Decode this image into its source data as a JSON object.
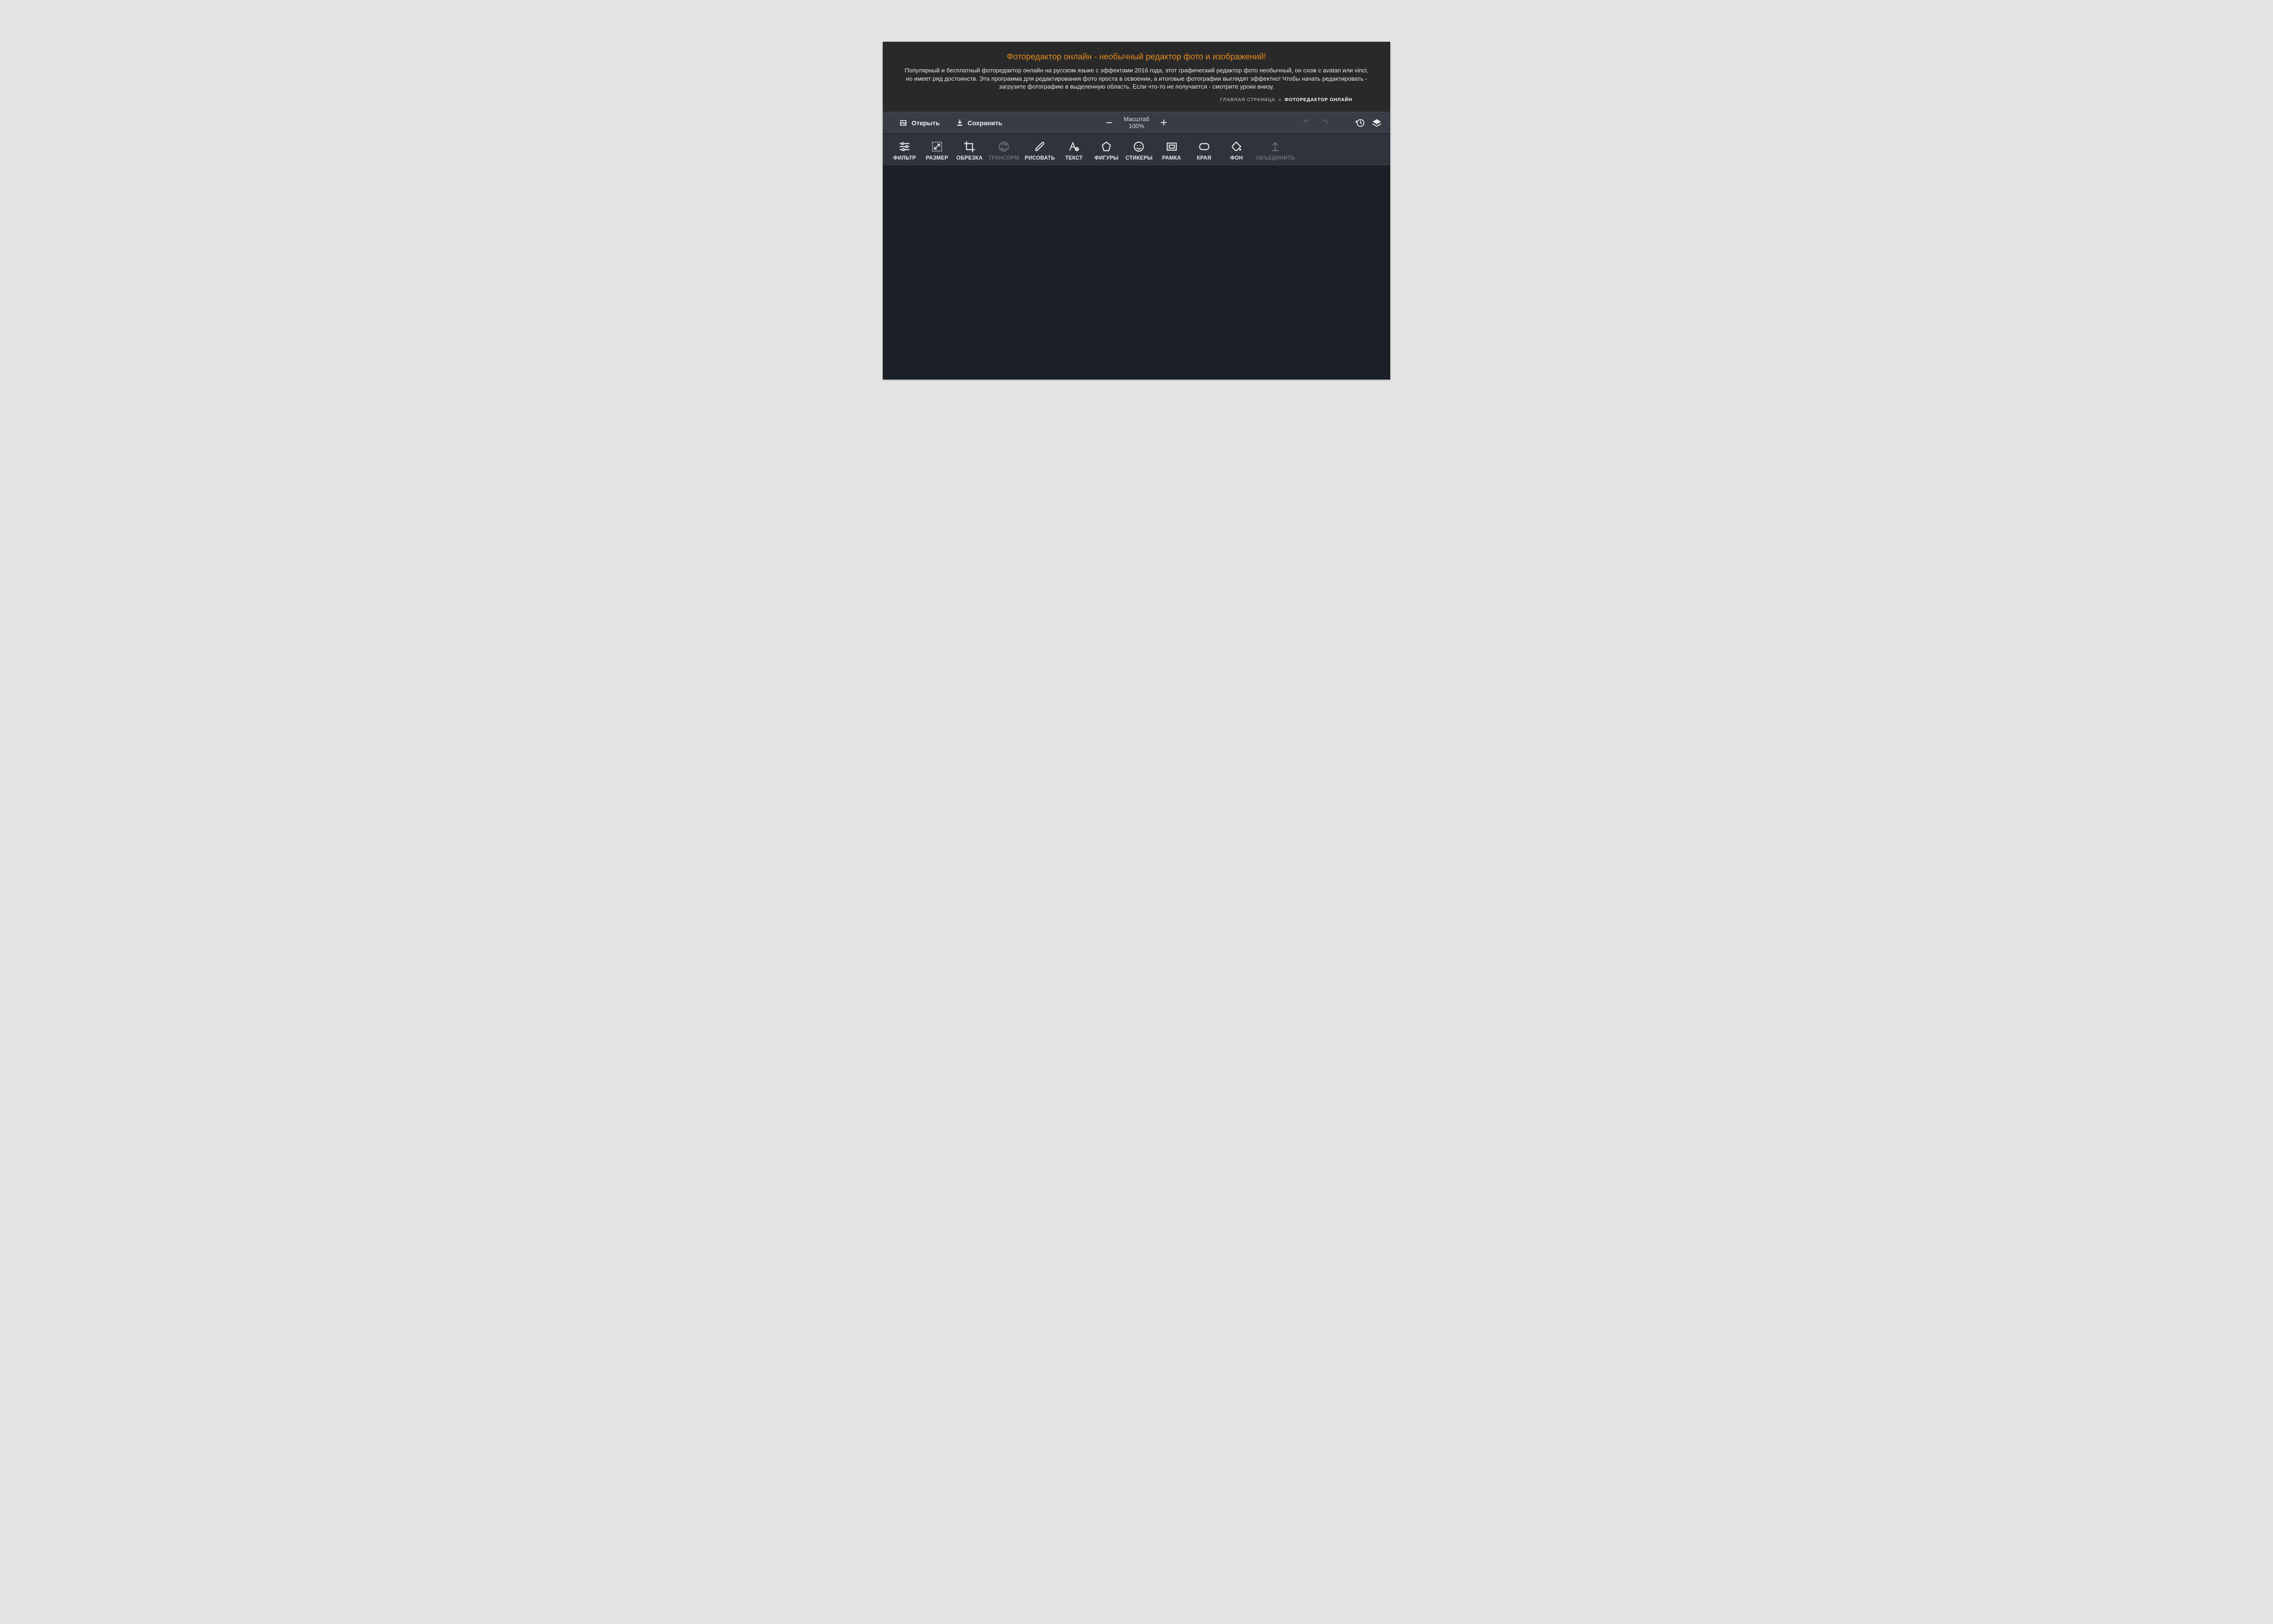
{
  "promo": {
    "title": "Фоторедактор онлайн - необычный редактор фото и изображений!",
    "description": "Популярный и бесплатный фоторедактор онлайн на русском языке с эффектами 2016 года, этот графический редактор фото необычный, он схож с avatan или vinci, но имеет ряд достоинств. Эта программа для редактирования фото проста в освоении, а итоговые фотографии выглядят эффектно! Чтобы начать редактировать - загрузите фотографию в выделенную область. Если что-то не получается - смотрите уроки внизу."
  },
  "breadcrumb": {
    "home": "ГЛАВНАЯ СТРАНИЦА",
    "separator": "»",
    "current": "ФОТОРЕДАКТОР ОНЛАЙН"
  },
  "actionbar": {
    "open": "Открыть",
    "save": "Сохранить",
    "zoom_label": "Масштаб",
    "zoom_value": "100%"
  },
  "tools": {
    "filter": "ФИЛЬТР",
    "size": "РАЗМЕР",
    "crop": "ОБРЕЗКА",
    "transform": "ТРАНСОРМ",
    "draw": "РИСОВАТЬ",
    "text": "ТЕКСТ",
    "shapes": "ФИГУРЫ",
    "stickers": "СТИКЕРЫ",
    "frame": "РАМКА",
    "edges": "КРАЯ",
    "bg": "ФОН",
    "merge": "ОБЪЕДИНИТЬ"
  }
}
